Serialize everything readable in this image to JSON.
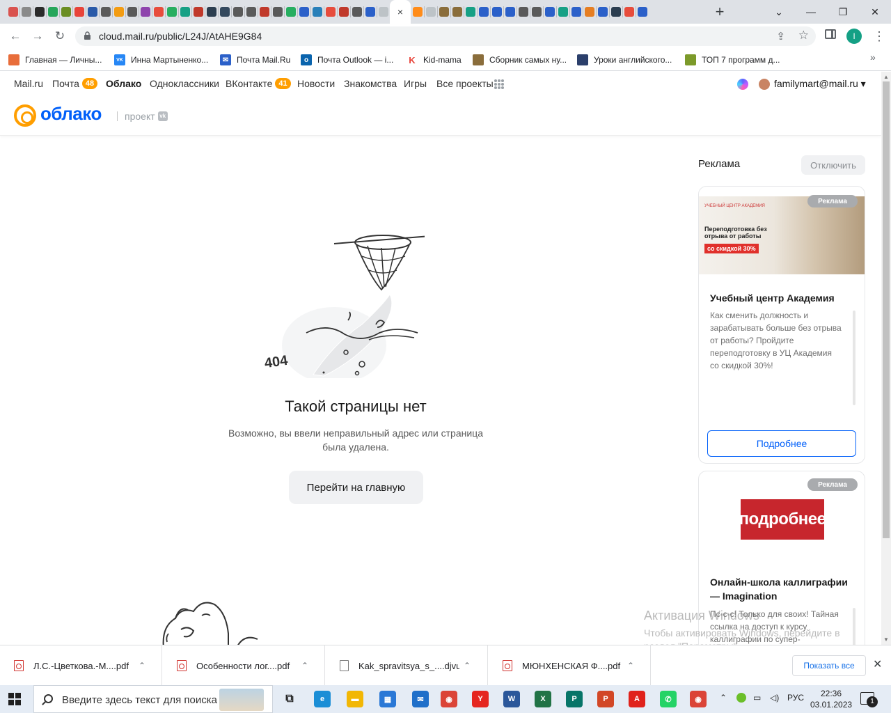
{
  "browser": {
    "tab_favicons": [
      "#d9534f",
      "#8a8a8a",
      "#2b2b2b",
      "#26a65b",
      "#6b8e23",
      "#e8443a",
      "#2a5aa8",
      "#5a5a5a",
      "#f39c12",
      "#5a5a5a",
      "#8e44ad",
      "#e74c3c",
      "#27ae60",
      "#16a085",
      "#c0392b",
      "#2c3e50",
      "#34495e",
      "#5a5a5a",
      "#5a5a5a",
      "#c0392b",
      "#5a5a5a",
      "#27ae60",
      "#2b60c9",
      "#2980b9",
      "#e74c3c",
      "#c0392b",
      "#5a5a5a",
      "#2b60c9",
      "#bdc3c7"
    ],
    "active_tab_close": "×",
    "right_favicons": [
      "#ff8c1a",
      "#bdc3c7",
      "#8a6d3b",
      "#8a6d3b",
      "#16a085",
      "#2b60c9",
      "#2b60c9",
      "#2b60c9",
      "#5a5a5a",
      "#5a5a5a",
      "#2b60c9",
      "#16a085",
      "#2b60c9",
      "#e67e22",
      "#2b60c9",
      "#2c3e50",
      "#e74c3c",
      "#2b60c9"
    ],
    "new_tab": "+",
    "window_controls": [
      "⌄",
      "—",
      "❐",
      "✕"
    ],
    "nav": {
      "back": "←",
      "forward": "→",
      "reload": "↻"
    },
    "url": "cloud.mail.ru/public/L24J/AtAHE9G84",
    "profile_initial": "I",
    "menu": "⋮",
    "bookmarks": [
      {
        "label": "Главная — Личны...",
        "color": "#e86d3a"
      },
      {
        "label": "Инна Мартыненко...",
        "color": "#2787f5",
        "glyph": "vk"
      },
      {
        "label": "Почта Mail.Ru",
        "color": "#2b60c9",
        "glyph": "✉"
      },
      {
        "label": "Почта Outlook — i...",
        "color": "#0a64ad",
        "glyph": "o"
      },
      {
        "label": "Kid-mama",
        "color": "#ffffff",
        "glyph": "K"
      },
      {
        "label": "Сборник самых ну...",
        "color": "#8a6d3b"
      },
      {
        "label": "Уроки английского...",
        "color": "#2b3f6b"
      },
      {
        "label": "ТОП 7 программ д...",
        "color": "#7c9a2a"
      }
    ],
    "bookmarks_more": "»"
  },
  "portal": {
    "items": [
      {
        "label": "Mail.ru"
      },
      {
        "label": "Почта",
        "badge": "48"
      },
      {
        "label": "Облако",
        "active": true
      },
      {
        "label": "Одноклассники"
      },
      {
        "label": "ВКонтакте",
        "badge": "41"
      },
      {
        "label": "Новости"
      },
      {
        "label": "Знакомства"
      },
      {
        "label": "Игры"
      },
      {
        "label": "Все проекты"
      }
    ],
    "user": "familymart@mail.ru ▾",
    "brand_accent": "#005ff9",
    "brand_orange": "#ff9e00"
  },
  "logo": {
    "text": "облако",
    "project": "проект",
    "vk": "vk"
  },
  "error": {
    "code": "404",
    "title": "Такой страницы нет",
    "description": "Возможно, вы ввели неправильный адрес или страница была удалена.",
    "button": "Перейти на главную"
  },
  "ads": {
    "title": "Реклама",
    "disable": "Отключить",
    "label": "Реклама",
    "card1": {
      "logo_text": "УЧЕБНЫЙ ЦЕНТР АКАДЕМИЯ",
      "image_heading": "Переподготовка без отрыва от работы",
      "image_badge": "со скидкой 30%",
      "name": "Учебный центр Академия",
      "text": "Как сменить должность и зарабатывать больше без отрыва от работы? Пройдите переподготовку в УЦ Академия со скидкой 30%!",
      "button": "Подробнее"
    },
    "card2": {
      "image_text": "подробнее",
      "name": "Онлайн-школа каллиграфии — Imagination",
      "text": "Пс-с-с! Только для своих! Тайная ссылка на доступ к курсу каллиграфии по супер-"
    }
  },
  "watermark": {
    "line1": "Активация Windows",
    "line2": "Чтобы активировать Windows, перейдите в раздел \"Параметры\"."
  },
  "downloads": {
    "items": [
      {
        "name": "Л.С.-Цветкова.-М....pdf",
        "type": "pdf"
      },
      {
        "name": "Особенности лог....pdf",
        "type": "pdf"
      },
      {
        "name": "Kak_spravitsya_s_....djvu",
        "type": "doc"
      },
      {
        "name": "МЮНХЕНСКАЯ Ф....pdf",
        "type": "pdf"
      }
    ],
    "chevron": "⌃",
    "show_all": "Показать все",
    "close": "✕"
  },
  "taskbar": {
    "search_placeholder": "Введите здесь текст для поиска",
    "apps": [
      {
        "name": "task-view",
        "color": "#3a3a3a",
        "glyph": "⧉"
      },
      {
        "name": "edge",
        "color": "#1b8ed6",
        "glyph": "e"
      },
      {
        "name": "explorer",
        "color": "#f2b705",
        "glyph": "▬"
      },
      {
        "name": "store",
        "color": "#2a78d6",
        "glyph": "▦"
      },
      {
        "name": "mail",
        "color": "#1f6fc9",
        "glyph": "✉"
      },
      {
        "name": "chrome",
        "color": "#db4437",
        "glyph": "◉"
      },
      {
        "name": "yandex",
        "color": "#e52620",
        "glyph": "Y"
      },
      {
        "name": "word",
        "color": "#2b579a",
        "glyph": "W"
      },
      {
        "name": "excel",
        "color": "#217346",
        "glyph": "X"
      },
      {
        "name": "publisher",
        "color": "#077568",
        "glyph": "P"
      },
      {
        "name": "powerpoint",
        "color": "#d24726",
        "glyph": "P"
      },
      {
        "name": "acrobat",
        "color": "#e0221b",
        "glyph": "A"
      },
      {
        "name": "whatsapp",
        "color": "#25d366",
        "glyph": "✆"
      },
      {
        "name": "chrome-active",
        "color": "#db4437",
        "glyph": "◉"
      }
    ],
    "tray": {
      "up": "⌃",
      "lang": "РУС"
    },
    "time": "22:36",
    "date": "03.01.2023",
    "notifications": "1"
  }
}
